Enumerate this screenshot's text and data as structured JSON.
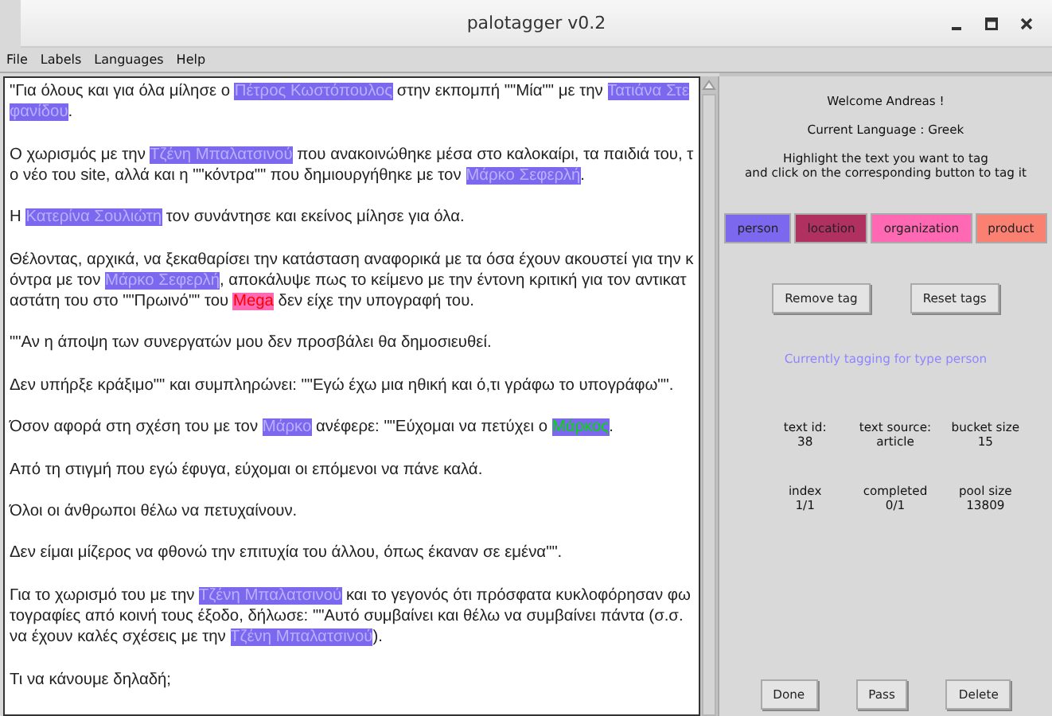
{
  "window": {
    "title": "palotagger v0.2"
  },
  "menu": [
    "File",
    "Labels",
    "Languages",
    "Help"
  ],
  "tags": [
    {
      "label": "person",
      "color": "#7b68ee"
    },
    {
      "label": "location",
      "color": "#b03060"
    },
    {
      "label": "organization",
      "color": "#ff69b4"
    },
    {
      "label": "product",
      "color": "#fa8072"
    }
  ],
  "paragraphs": [
    [
      {
        "text": "\"Για όλους και για όλα μίλησε ο "
      },
      {
        "text": "Πέτρος Κωστόπουλος",
        "color": "#7b68ee",
        "selected": false
      },
      {
        "text": " στην εκπομπή \"\"Μία\"\" με την "
      },
      {
        "text": "Τατιάνα Στεφανίδου",
        "color": "#7b68ee",
        "selected": false
      },
      {
        "text": "."
      }
    ],
    [
      {
        "text": "Ο χωρισμός με την "
      },
      {
        "text": "Τζένη Μπαλατσινού",
        "color": "#7b68ee",
        "selected": false
      },
      {
        "text": " που ανακοινώθηκε μέσα στο καλοκαίρι, τα παιδιά του, το νέο του site, αλλά και η \"\"κόντρα\"\" που δημιουργήθηκε με τον "
      },
      {
        "text": "Μάρκο Σεφερλή",
        "color": "#7b68ee",
        "selected": false
      },
      {
        "text": "."
      }
    ],
    [
      {
        "text": "Η "
      },
      {
        "text": "Κατερίνα Σουλιώτη",
        "color": "#7b68ee",
        "selected": false
      },
      {
        "text": " τον συνάντησε και εκείνος μίλησε για όλα."
      }
    ],
    [
      {
        "text": "Θέλοντας, αρχικά, να ξεκαθαρίσει την κατάσταση αναφορικά με τα όσα έχουν ακουστεί για την κόντρα με τον "
      },
      {
        "text": "Μάρκο Σεφερλή",
        "color": "#7b68ee",
        "selected": false
      },
      {
        "text": ", αποκάλυψε πως το κείμενο με την έντονη κριτική για τον αντικαταστάτη του στο \"\"Πρωινό\"\" του "
      },
      {
        "text": "Mega",
        "color": "#ff69b4",
        "selected": false
      },
      {
        "text": " δεν είχε την υπογραφή του."
      }
    ],
    [
      {
        "text": "\"\"Αν η άποψη των συνεργατών μου δεν προσβάλει θα δημοσιευθεί."
      }
    ],
    [
      {
        "text": "Δεν υπήρξε κράξιμο\"\" και συμπληρώνει: \"\"Εγώ έχω μια ηθική και ό,τι γράφω το υπογράφω\"\"."
      }
    ],
    [
      {
        "text": "Όσον αφορά στη σχέση του με τον "
      },
      {
        "text": "Μάρκο",
        "color": "#7b68ee",
        "selected": false
      },
      {
        "text": " ανέφερε: \"\"Εύχομαι να πετύχει ο "
      },
      {
        "text": "Μάρκος",
        "color": "#7b68ee",
        "selected": true
      },
      {
        "text": "."
      }
    ],
    [
      {
        "text": "Από τη στιγμή που εγώ έφυγα, εύχομαι οι επόμενοι να πάνε καλά."
      }
    ],
    [
      {
        "text": "Όλοι οι άνθρωποι θέλω να πετυχαίνουν."
      }
    ],
    [
      {
        "text": "Δεν είμαι μίζερος να φθονώ την επιτυχία του άλλου, όπως έκαναν σε εμένα\"\"."
      }
    ],
    [
      {
        "text": "Για το χωρισμό του με την "
      },
      {
        "text": "Τζένη Μπαλατσινού",
        "color": "#7b68ee",
        "selected": false
      },
      {
        "text": " και το γεγονός ότι πρόσφατα κυκλοφόρησαν φωτογραφίες από κοινή τους έξοδο, δήλωσε: \"\"Αυτό συμβαίνει και θέλω να συμβαίνει πάντα (σ.σ. να έχουν καλές σχέσεις με την "
      },
      {
        "text": "Τζένη Μπαλατσινού",
        "color": "#7b68ee",
        "selected": false
      },
      {
        "text": ")."
      }
    ],
    [
      {
        "text": "Τι να κάνουμε δηλαδή;"
      }
    ]
  ],
  "welcome": "Welcome Andreas !",
  "language": "Current Language : Greek",
  "instructions": [
    "Highlight the text you want to tag",
    "and click on the corresponding button to tag it"
  ],
  "tag_actions": [
    "Remove tag",
    "Reset tags"
  ],
  "status": "Currently tagging for type person",
  "stats": [
    {
      "label": "text id:",
      "value": "38"
    },
    {
      "label": "text source:",
      "value": "article"
    },
    {
      "label": "bucket size",
      "value": "15"
    },
    {
      "label": "index",
      "value": "1/1"
    },
    {
      "label": "completed",
      "value": "0/1"
    },
    {
      "label": "pool size",
      "value": "13809"
    }
  ],
  "buttons": [
    "Done",
    "Pass",
    "Delete"
  ]
}
